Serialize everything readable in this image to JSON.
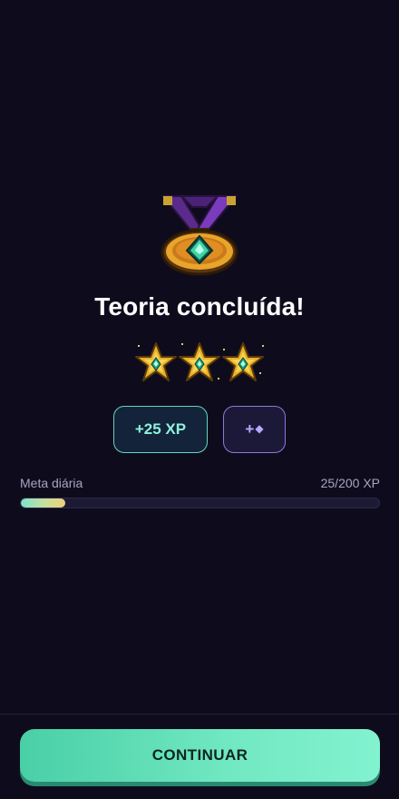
{
  "icons": {
    "medal": "medal-icon",
    "star": "star-icon",
    "gem": "gem-icon"
  },
  "result": {
    "title": "Teoria concluída!",
    "stars_earned": 3,
    "stars_total": 3
  },
  "rewards": {
    "xp_label": "+25 XP",
    "gem_prefix": "+",
    "gem_glyph": "◆"
  },
  "daily_goal": {
    "label": "Meta diária",
    "value_text": "25/200 XP",
    "current": 25,
    "target": 200
  },
  "footer": {
    "continue_label": "CONTINUAR"
  },
  "colors": {
    "background": "#0e0c1c",
    "accent_mint": "#62d7bf",
    "accent_purple": "#8d78dc",
    "button": "#5fdcb4",
    "gold": "#e9b02a"
  }
}
